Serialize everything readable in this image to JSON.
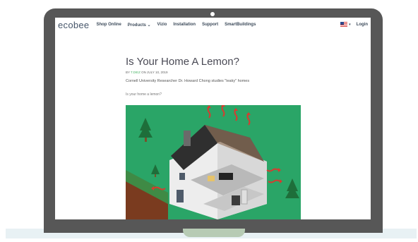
{
  "browser": {
    "logo": "ecobee",
    "nav": [
      "Shop Online",
      "Products",
      "Vizio",
      "Installation",
      "Support",
      "SmartBuildings"
    ],
    "products_caret": "⌄",
    "flag_caret": "▾",
    "login": "Login"
  },
  "article": {
    "title": "Is Your Home A Lemon?",
    "byline_prefix": "BY",
    "author": "T.DIEZ",
    "byline_date": "ON JULY 10, 2019",
    "subtitle": "Cornell University Researcher Dr. Howard Chong studies \"leaky\" homes",
    "lead": "Is your home a lemon?"
  },
  "colors": {
    "bezel": "#575757",
    "hero_bg": "#2aa567",
    "heat_arrows": "#d93a2f",
    "author_link": "#4db76a"
  }
}
